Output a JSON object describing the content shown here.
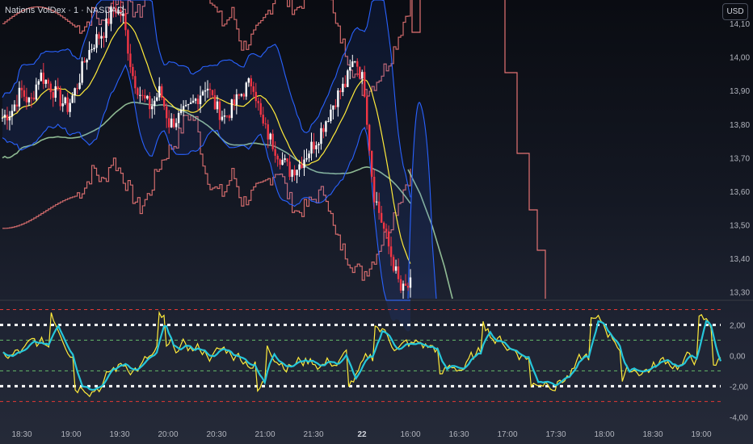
{
  "header": {
    "symbol_title": "Nations VolDex · 1 · NASDAQ",
    "currency": "USD"
  },
  "colors": {
    "candle_up": "#ffffff",
    "candle_down": "#f23645",
    "bollinger": "#2962ff",
    "outer_band": "#e57373",
    "slow_band": "#a5d6a7",
    "basis": "#ffeb3b",
    "osc_fast": "#ffeb3b",
    "osc_slow": "#26c6da",
    "level_dotted": "#ffffff",
    "level_red": "#e53935",
    "level_green": "#66bb6a"
  },
  "chart_data": [
    {
      "type": "candlestick",
      "y_ticks": [
        "14,10",
        "14,00",
        "13,90",
        "13,80",
        "13,70",
        "13,60",
        "13,50",
        "13,40",
        "13,30"
      ],
      "y_tick_values": [
        14.1,
        14.0,
        13.9,
        13.8,
        13.7,
        13.6,
        13.5,
        13.4,
        13.3
      ],
      "ylim": [
        13.28,
        14.17
      ],
      "closes": [
        13.82,
        13.84,
        13.9,
        13.86,
        13.95,
        13.92,
        13.88,
        13.85,
        13.91,
        14.0,
        14.05,
        14.08,
        14.15,
        14.12,
        13.95,
        13.88,
        13.85,
        13.9,
        13.8,
        13.82,
        13.84,
        13.88,
        13.92,
        13.85,
        13.82,
        13.86,
        13.9,
        13.93,
        13.8,
        13.75,
        13.7,
        13.66,
        13.68,
        13.72,
        13.76,
        13.82,
        13.88,
        13.92,
        14.0,
        13.92,
        13.6,
        13.5,
        13.4,
        13.3,
        13.32
      ],
      "slow_band_upper": [
        13.95,
        13.96,
        13.96,
        13.97,
        13.98,
        13.99,
        14.0,
        14.0,
        14.01
      ],
      "slow_band_lower": [
        13.6,
        13.65,
        13.68,
        13.72,
        13.76,
        13.8,
        13.85,
        13.88,
        13.9
      ]
    },
    {
      "type": "line",
      "y_ticks": [
        "2,00",
        "0,00",
        "-2,00",
        "-4,00"
      ],
      "y_tick_values": [
        2,
        0,
        -2,
        -4
      ],
      "ylim": [
        -4.3,
        3.5
      ],
      "levels_dotted": [
        2,
        -2
      ],
      "levels_red": [
        3,
        -3
      ],
      "levels_green": [
        1,
        -1
      ],
      "x_ticks": [
        "18:30",
        "19:00",
        "19:30",
        "20:00",
        "20:30",
        "21:00",
        "21:30",
        "22",
        "16:00",
        "16:30",
        "17:00",
        "17:30",
        "18:00",
        "18:30",
        "19:00"
      ]
    }
  ]
}
